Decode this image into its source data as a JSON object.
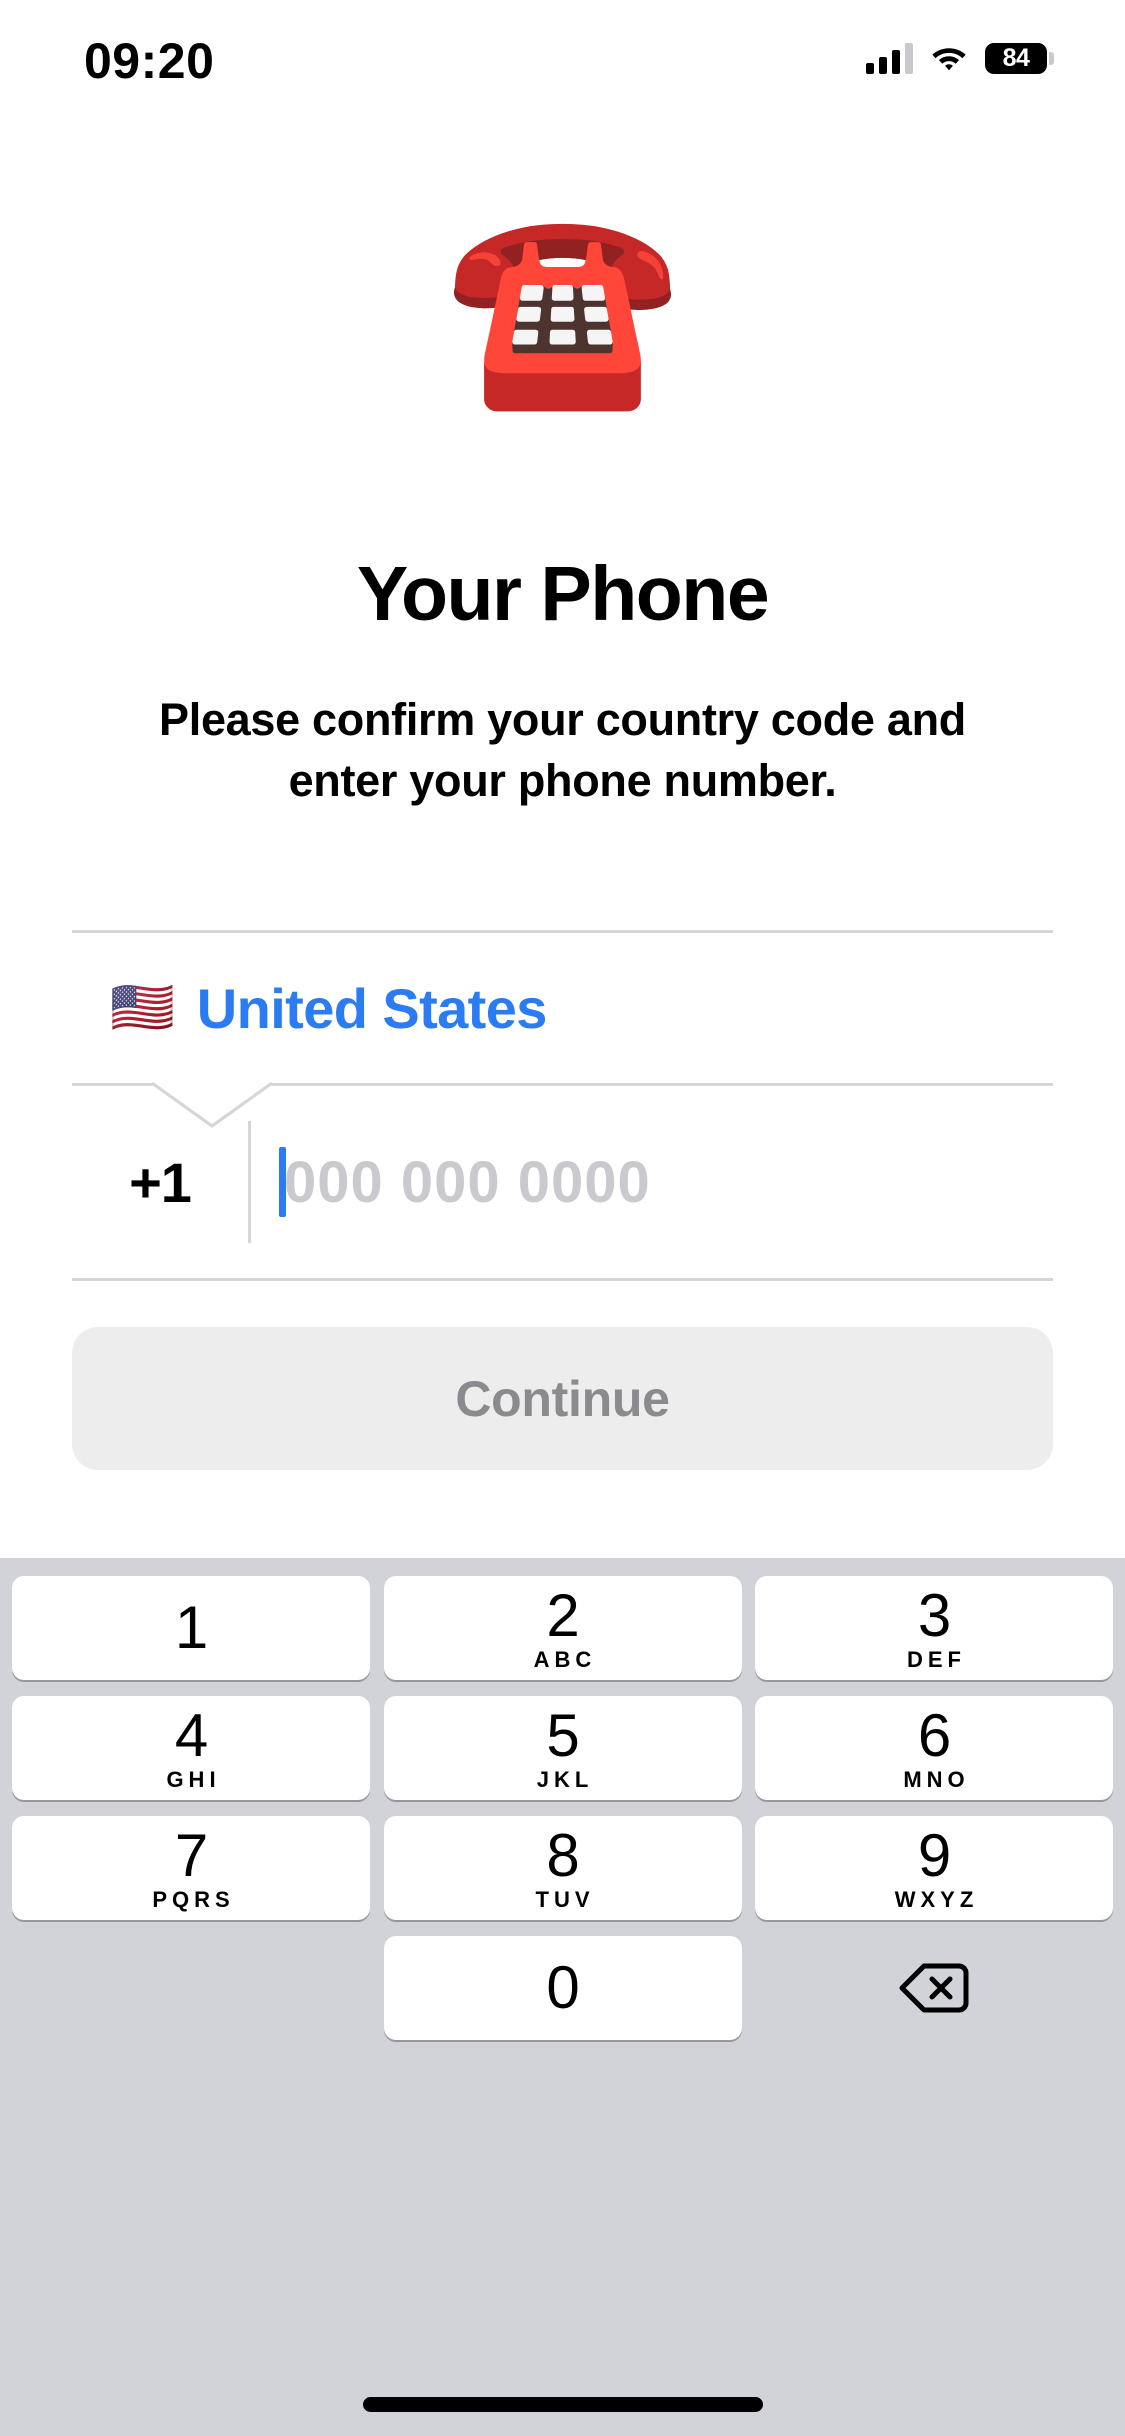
{
  "status_bar": {
    "time": "09:20",
    "battery_level": "84",
    "cellular_icon": "signal-bars-icon",
    "wifi_icon": "wifi-icon",
    "battery_icon": "battery-icon"
  },
  "hero": {
    "emoji": "☎️",
    "emoji_name": "telephone-emoji",
    "title": "Your Phone",
    "subtitle": "Please confirm your country code and enter your phone number."
  },
  "form": {
    "country": {
      "flag": "🇺🇸",
      "name": "United States",
      "color": "#2b7bf3"
    },
    "dial_code": "+1",
    "phone_value": "",
    "phone_placeholder": "000 000 0000",
    "caret_color": "#2b7bf3"
  },
  "continue_button": {
    "label": "Continue",
    "enabled": false,
    "background": "#ededed",
    "text_color": "#8a8a8f"
  },
  "keypad": {
    "background": "#d1d3d9",
    "rows": [
      [
        {
          "digit": "1",
          "letters": "",
          "name": "key-1"
        },
        {
          "digit": "2",
          "letters": "ABC",
          "name": "key-2"
        },
        {
          "digit": "3",
          "letters": "DEF",
          "name": "key-3"
        }
      ],
      [
        {
          "digit": "4",
          "letters": "GHI",
          "name": "key-4"
        },
        {
          "digit": "5",
          "letters": "JKL",
          "name": "key-5"
        },
        {
          "digit": "6",
          "letters": "MNO",
          "name": "key-6"
        }
      ],
      [
        {
          "digit": "7",
          "letters": "PQRS",
          "name": "key-7"
        },
        {
          "digit": "8",
          "letters": "TUV",
          "name": "key-8"
        },
        {
          "digit": "9",
          "letters": "WXYZ",
          "name": "key-9"
        }
      ]
    ],
    "zero": {
      "digit": "0",
      "letters": "",
      "name": "key-0"
    },
    "backspace_icon": "backspace-icon"
  },
  "home_indicator": "home-indicator"
}
